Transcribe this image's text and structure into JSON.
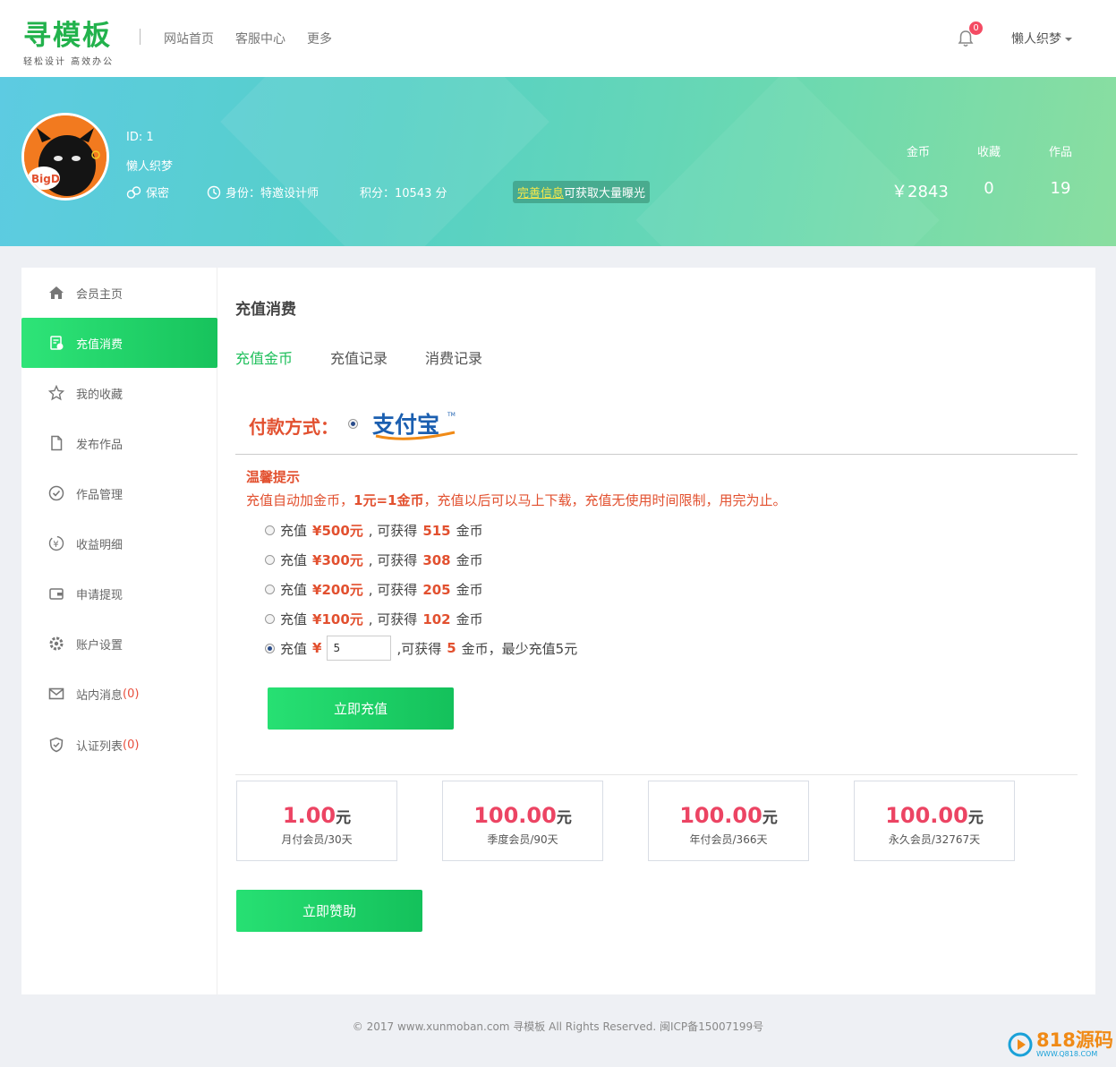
{
  "header": {
    "logo_text": "寻模板",
    "logo_slogan": "轻松设计 高效办公",
    "nav": [
      "网站首页",
      "客服中心",
      "更多"
    ],
    "notification_count": "0",
    "user_name": "懒人织梦"
  },
  "profile": {
    "avatar_text": "BigD",
    "id_text": "ID: 1",
    "name": "懒人织梦",
    "gender": "保密",
    "identity": "身份：特邀设计师",
    "points": "积分：10543 分",
    "complete_link": "完善信息",
    "complete_rest": "可获取大量曝光",
    "stats": [
      {
        "label": "金币",
        "value": "￥2843"
      },
      {
        "label": "收藏",
        "value": "0"
      },
      {
        "label": "作品",
        "value": "19"
      }
    ]
  },
  "sidebar": {
    "items": [
      {
        "label": "会员主页",
        "icon": "home-icon"
      },
      {
        "label": "充值消费",
        "icon": "bill-icon",
        "active": true
      },
      {
        "label": "我的收藏",
        "icon": "star-icon"
      },
      {
        "label": "发布作品",
        "icon": "file-icon"
      },
      {
        "label": "作品管理",
        "icon": "check-circle-icon"
      },
      {
        "label": "收益明细",
        "icon": "yen-circle-icon"
      },
      {
        "label": "申请提现",
        "icon": "wallet-icon"
      },
      {
        "label": "账户设置",
        "icon": "gear-icon"
      },
      {
        "label": "站内消息",
        "icon": "mail-icon",
        "count": "(0)"
      },
      {
        "label": "认证列表",
        "icon": "shield-icon",
        "count": "(0)"
      }
    ]
  },
  "content": {
    "title": "充值消费",
    "tabs": [
      "充值金币",
      "充值记录",
      "消费记录"
    ],
    "pay_method_label": "付款方式：",
    "alipay_logo": "支付宝",
    "tip_title": "温馨提示",
    "tip_text_1": "充值自动加金币，",
    "tip_text_bold": "1元=1金币",
    "tip_text_2": "，充值以后可以马上下载，充值无使用时间限制，用完为止。",
    "options": [
      {
        "prefix": "充值",
        "amount": "¥500元",
        "mid": ", 可获得",
        "coins": "515",
        "unit": "金币"
      },
      {
        "prefix": "充值",
        "amount": "¥300元",
        "mid": ", 可获得",
        "coins": "308",
        "unit": "金币"
      },
      {
        "prefix": "充值",
        "amount": "¥200元",
        "mid": ", 可获得",
        "coins": "205",
        "unit": "金币"
      },
      {
        "prefix": "充值",
        "amount": "¥100元",
        "mid": ", 可获得",
        "coins": "102",
        "unit": "金币"
      }
    ],
    "custom": {
      "prefix": "充值",
      "currency": "¥",
      "input_value": "5",
      "mid": ",可获得",
      "coins": "5",
      "suffix": "金币，最少充值5元"
    },
    "recharge_button": "立即充值",
    "plans": [
      {
        "price": "1.00",
        "unit": "元",
        "name": "月付会员/30天"
      },
      {
        "price": "100.00",
        "unit": "元",
        "name": "季度会员/90天"
      },
      {
        "price": "100.00",
        "unit": "元",
        "name": "年付会员/366天"
      },
      {
        "price": "100.00",
        "unit": "元",
        "name": "永久会员/32767天"
      }
    ],
    "sponsor_button": "立即赞助"
  },
  "footer": {
    "text": "© 2017 www.xunmoban.com 寻模板 All Rights Reserved. 闽ICP备15007199号"
  },
  "watermark": {
    "text": "818源码",
    "sub": "WWW.Q818.COM"
  },
  "colors": {
    "brand_green": "#22b24c",
    "accent_red": "#e2502f",
    "price_pink": "#ec4463"
  }
}
